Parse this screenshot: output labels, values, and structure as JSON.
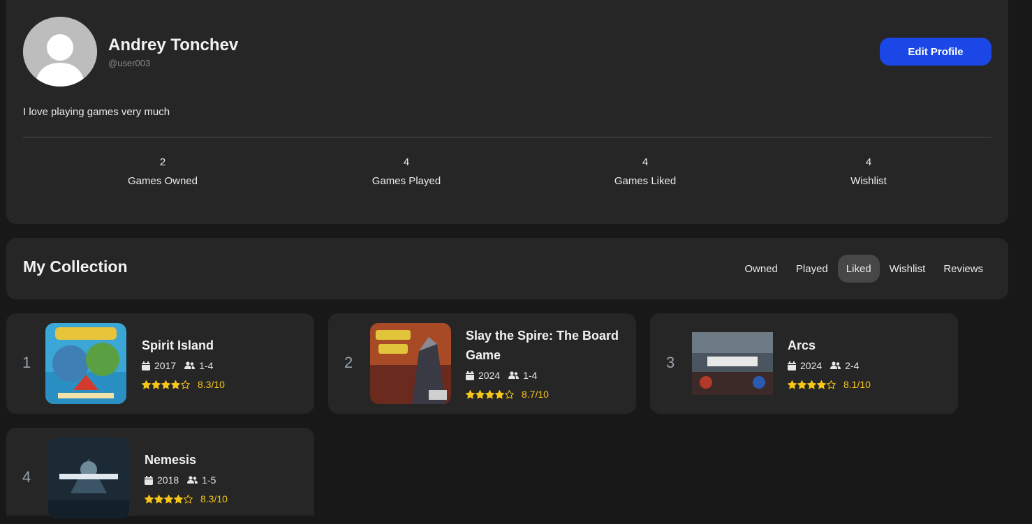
{
  "profile": {
    "name": "Andrey Tonchev",
    "handle": "@user003",
    "edit_label": "Edit Profile",
    "bio": "I love playing games very much",
    "stats": [
      {
        "value": "2",
        "label": "Games Owned"
      },
      {
        "value": "4",
        "label": "Games Played"
      },
      {
        "value": "4",
        "label": "Games Liked"
      },
      {
        "value": "4",
        "label": "Wishlist"
      }
    ]
  },
  "collection": {
    "title": "My Collection",
    "tabs": [
      "Owned",
      "Played",
      "Liked",
      "Wishlist",
      "Reviews"
    ],
    "active_tab": "Liked"
  },
  "games": [
    {
      "rank": "1",
      "title": "Spirit Island",
      "year": "2017",
      "players": "1-4",
      "rating": "8.3/10",
      "stars": 4
    },
    {
      "rank": "2",
      "title": "Slay the Spire: The Board Game",
      "year": "2024",
      "players": "1-4",
      "rating": "8.7/10",
      "stars": 4
    },
    {
      "rank": "3",
      "title": "Arcs",
      "year": "2024",
      "players": "2-4",
      "rating": "8.1/10",
      "stars": 4
    },
    {
      "rank": "4",
      "title": "Nemesis",
      "year": "2018",
      "players": "1-5",
      "rating": "8.3/10",
      "stars": 4
    }
  ],
  "colors": {
    "accent": "#1a47e6",
    "star": "#f5c518",
    "background": "#181818",
    "card": "#262626"
  }
}
